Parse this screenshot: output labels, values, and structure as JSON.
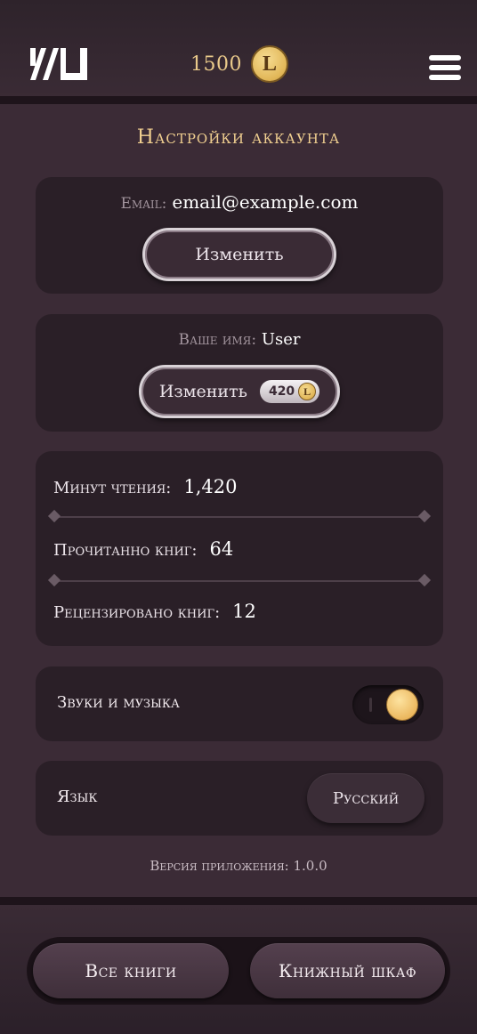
{
  "header": {
    "coins": "1500",
    "coin_symbol": "L",
    "logo_icon": "brand-logo-icon",
    "menu_icon": "hamburger-menu-icon"
  },
  "page": {
    "title": "Настройки аккаунта"
  },
  "account": {
    "email_label": "Email:",
    "email_value": "email@example.com",
    "email_change_label": "Изменить",
    "name_label": "Ваше имя:",
    "name_value": "User",
    "name_change_label": "Изменить",
    "name_change_price": "420",
    "price_coin_symbol": "L"
  },
  "stats": [
    {
      "label": "Минут чтения:",
      "value": "1,420"
    },
    {
      "label": "Прочитанно книг:",
      "value": "64"
    },
    {
      "label": "Рецензировано книг:",
      "value": "12"
    }
  ],
  "settings": {
    "sound_label": "Звуки и музыка",
    "sound_enabled": true,
    "language_label": "Язык",
    "language_value": "Русский"
  },
  "version_text": "Версия приложения: 1.0.0",
  "nav": {
    "all_books": "Все книги",
    "bookshelf": "Книжный шкаф"
  },
  "colors": {
    "background": "#3b2b36",
    "card": "#2a1f27",
    "accent_gold": "#f0cf90"
  }
}
